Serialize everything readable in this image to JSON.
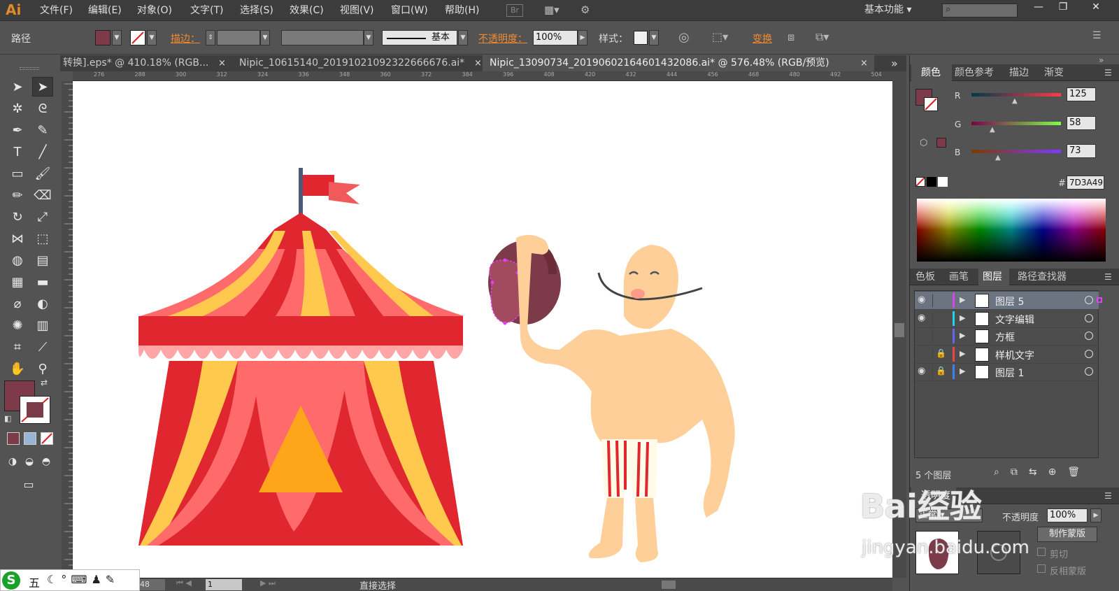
{
  "app": {
    "logo": "Ai",
    "workspace": "基本功能"
  },
  "menu": [
    "文件(F)",
    "编辑(E)",
    "对象(O)",
    "文字(T)",
    "选择(S)",
    "效果(C)",
    "视图(V)",
    "窗口(W)",
    "帮助(H)"
  ],
  "menu_extra": {
    "bridge": "Br"
  },
  "window_controls": {
    "minimize": "—",
    "restore": "❐",
    "close": "✕"
  },
  "control": {
    "object_type": "路径",
    "fill_color": "#7D3A49",
    "stroke_label": "描边：",
    "stroke_style": "基本",
    "opacity_label": "不透明度：",
    "opacity_value": "100%",
    "style_label": "样式：",
    "transform_label": "变换"
  },
  "tabs": [
    {
      "label": "转换].eps* @ 410.18% (RGB...",
      "active": false
    },
    {
      "label": "Nipic_10615140_20191021092322666676.ai*",
      "active": false
    },
    {
      "label": "Nipic_13090734_20190602164601432086.ai* @ 576.48% (RGB/预览)",
      "active": true
    }
  ],
  "tab_close": "×",
  "tab_overflow": "»",
  "ruler_ticks": [
    "276",
    "288",
    "300",
    "312",
    "324",
    "336",
    "348",
    "360",
    "372",
    "384",
    "396",
    "408",
    "420",
    "432",
    "444",
    "456",
    "468",
    "480",
    "492",
    "504"
  ],
  "color_panel": {
    "tabs": [
      "颜色",
      "颜色参考",
      "描边",
      "渐变"
    ],
    "r_label": "R",
    "g_label": "G",
    "b_label": "B",
    "r": "125",
    "g": "58",
    "b": "73",
    "hex_label": "#",
    "hex": "7D3A49",
    "fill": "#7D3A49"
  },
  "layers_panel": {
    "tabs": [
      "色板",
      "画笔",
      "图层",
      "路径查找器"
    ],
    "layers": [
      {
        "name": "图层 5",
        "color": "#d946ef",
        "visible": true,
        "locked": false,
        "selected": true
      },
      {
        "name": "文字编辑",
        "color": "#22d3ee",
        "visible": true,
        "locked": false,
        "selected": false
      },
      {
        "name": "方框",
        "color": "#6366f1",
        "visible": false,
        "locked": false,
        "selected": false
      },
      {
        "name": "样机文字",
        "color": "#ef4444",
        "visible": false,
        "locked": true,
        "selected": false
      },
      {
        "name": "图层 1",
        "color": "#3b82f6",
        "visible": true,
        "locked": true,
        "selected": false
      }
    ],
    "count": "5 个图层"
  },
  "transparency_panel": {
    "title": "透明度",
    "mode": "正常",
    "opacity_label": "不透明度",
    "opacity": "100%",
    "make_mask": "制作蒙版",
    "clip": "剪切",
    "invert": "反相蒙版"
  },
  "status": {
    "zoom": "48",
    "page": "1",
    "tool": "直接选择"
  },
  "ime": {
    "logo": "S",
    "mode": "五"
  },
  "watermark": {
    "main": "Bai经验",
    "sub": "jingyan.baidu.com"
  }
}
